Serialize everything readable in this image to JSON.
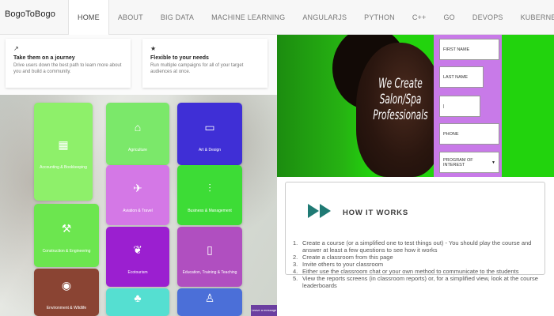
{
  "brand": "BogoToBogo",
  "nav": [
    {
      "label": "HOME",
      "active": true
    },
    {
      "label": "ABOUT"
    },
    {
      "label": "BIG DATA"
    },
    {
      "label": "MACHINE LEARNING"
    },
    {
      "label": "ANGULARJS"
    },
    {
      "label": "PYTHON"
    },
    {
      "label": "C++"
    },
    {
      "label": "GO"
    },
    {
      "label": "DEVOPS"
    },
    {
      "label": "KUBERNETES"
    }
  ],
  "features": [
    {
      "icon": "route-icon",
      "glyph": "↗",
      "title": "Take them on a journey",
      "desc": "Drive users down the best path to learn more about you and build a community."
    },
    {
      "icon": "star-icon",
      "glyph": "★",
      "title": "Flexible to your needs",
      "desc": "Run multiple campaigns for all of your target audiences at once."
    }
  ],
  "tiles": [
    {
      "label": "Accounting & Bookkeeping",
      "color": "#8ef06a",
      "icon": "calculator-icon",
      "glyph": "▦"
    },
    {
      "label": "Agriculture",
      "color": "#7be86a",
      "icon": "farm-icon",
      "glyph": "⌂"
    },
    {
      "label": "Art & Design",
      "color": "#3f2fd6",
      "icon": "monitor-icon",
      "glyph": "▭"
    },
    {
      "label": "Construction & Engineering",
      "color": "#6ce64f",
      "icon": "crane-icon",
      "glyph": "⚒"
    },
    {
      "label": "Aviation & Travel",
      "color": "#d478e6",
      "icon": "airplane-icon",
      "glyph": "✈"
    },
    {
      "label": "Business & Management",
      "color": "#3ddc36",
      "icon": "chart-icon",
      "glyph": "⫶"
    },
    {
      "label": "Ecotourism",
      "color": "#9b1fd0",
      "icon": "leaf-icon",
      "glyph": "❦"
    },
    {
      "label": "Education, Training & Teaching",
      "color": "#b04fc0",
      "icon": "tablet-icon",
      "glyph": "▯"
    },
    {
      "label": "Environment & Wildlife",
      "color": "#8a4433",
      "icon": "globe-icon",
      "glyph": "◉"
    },
    {
      "label": "",
      "color": "#55dfd1",
      "icon": "leaf-icon",
      "glyph": "♣"
    },
    {
      "label": "",
      "color": "#4b6fd8",
      "icon": "person-icon",
      "glyph": "♙"
    }
  ],
  "chat_label": "Leave a message",
  "banner": {
    "tagline": "We Create Salon/Spa Professionals"
  },
  "form": {
    "first_name": "FIRST NAME",
    "last_name": "LAST NAME",
    "email": "|",
    "phone": "PHONE",
    "program": "PROGRAM OF INTEREST"
  },
  "how": {
    "title": "HOW IT WORKS",
    "steps": [
      "Create a course (or a simplified one to test things out) - You should play the course and answer at least a few questions to see how it works",
      "Create a classroom from this page",
      "Invite others to your classroom",
      "Either use the classroom chat or your own method to communicate to the students",
      "View the reports screens (in classroom reports) or, for a simplified view, look at the course leaderboards"
    ]
  },
  "colors": {
    "accent_green": "#22d30d",
    "form_purple": "#c87ae8",
    "how_icon_teal": "#1f7a74"
  }
}
